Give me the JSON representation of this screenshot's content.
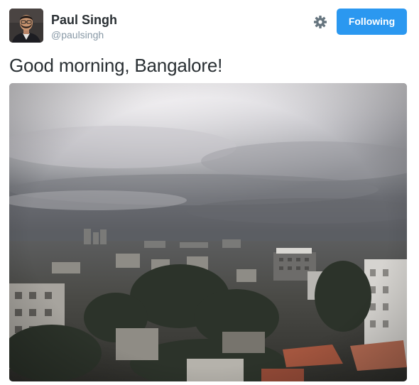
{
  "author": {
    "name": "Paul Singh",
    "handle": "@paulsingh"
  },
  "actions": {
    "follow_label": "Following"
  },
  "tweet": {
    "text": "Good morning, Bangalore!"
  },
  "icons": {
    "settings": "gear-icon"
  },
  "colors": {
    "accent": "#2b98f0",
    "name_text": "#292f33",
    "handle_text": "#8899a6"
  }
}
